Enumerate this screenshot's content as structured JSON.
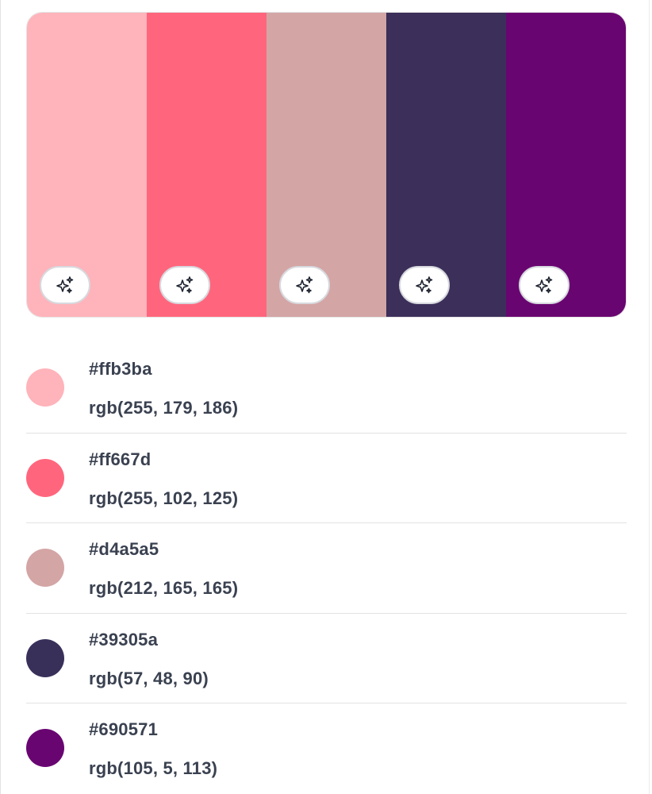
{
  "palette": {
    "colors": [
      {
        "hex": "#ffb3ba",
        "rgb": "rgb(255, 179, 186)",
        "swatch_color": "#ffb3ba",
        "action_icon": "sparkles-icon"
      },
      {
        "hex": "#ff667d",
        "rgb": "rgb(255, 102, 125)",
        "swatch_color": "#ff667d",
        "action_icon": "sparkles-icon"
      },
      {
        "hex": "#d4a5a5",
        "rgb": "rgb(212, 165, 165)",
        "swatch_color": "#d4a5a5",
        "action_icon": "sparkles-icon"
      },
      {
        "hex": "#39305a",
        "rgb": "rgb(57, 48, 90)",
        "swatch_color": "#3c2f5a",
        "action_icon": "sparkles-icon"
      },
      {
        "hex": "#690571",
        "rgb": "rgb(105, 5, 113)",
        "swatch_color": "#690571",
        "action_icon": "sparkles-icon"
      }
    ]
  },
  "theme": {
    "text_color": "#3a4150",
    "divider_color": "#e2e2e2",
    "button_border": "#d7d9de"
  }
}
